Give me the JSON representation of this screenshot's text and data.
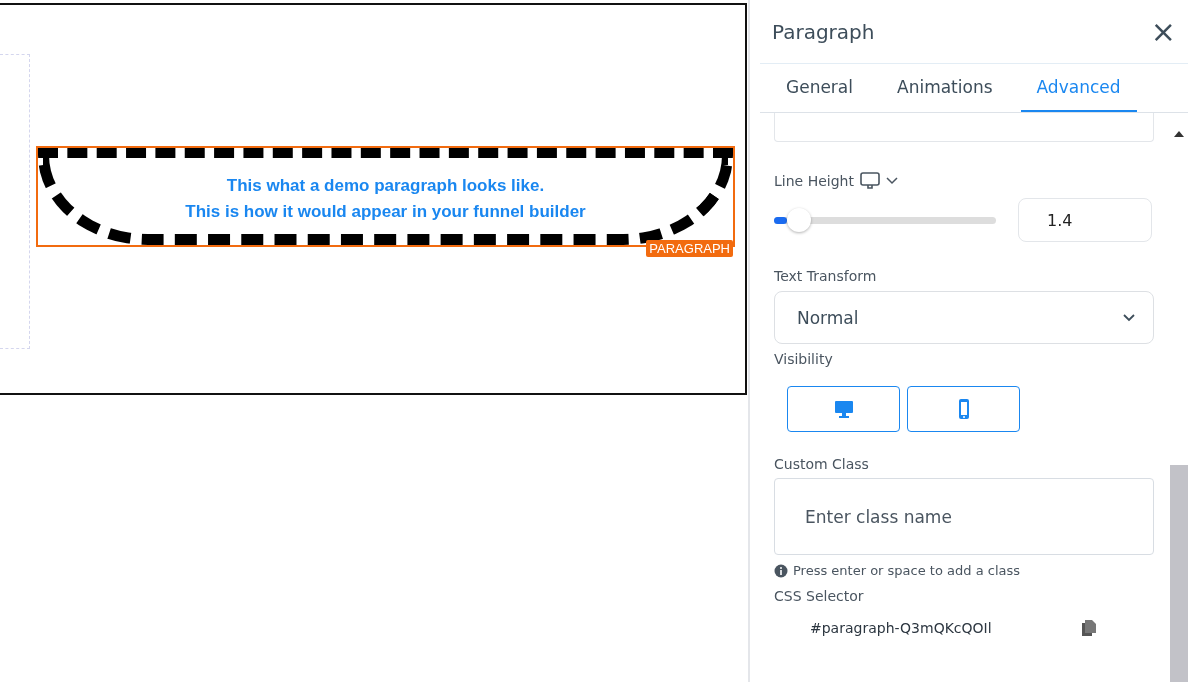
{
  "canvas": {
    "paragraph": {
      "lines": [
        "This what a demo paragraph looks like.",
        "This is how it would appear in your funnel builder"
      ],
      "badge": "PARAGRAPH",
      "selected": true
    }
  },
  "panel": {
    "title": "Paragraph",
    "close": "×",
    "tabs": [
      {
        "label": "General",
        "selected": false
      },
      {
        "label": "Animations",
        "selected": false
      },
      {
        "label": "Advanced",
        "selected": true
      }
    ],
    "line_height": {
      "label": "Line Height",
      "level": 0.06,
      "value": "1.4"
    },
    "text_transform": {
      "label": "Text Transform",
      "value": "Normal"
    },
    "visibility": {
      "label": "Visibility",
      "buttons": [
        {
          "kind": "desktop"
        },
        {
          "kind": "mobile"
        }
      ]
    },
    "custom_class": {
      "label": "Custom Class",
      "placeholder": "Enter class name",
      "hint": "Press enter or space to add a class"
    },
    "css_selector": {
      "label": "CSS Selector",
      "value": "#paragraph-Q3mQKcQOIl"
    }
  }
}
